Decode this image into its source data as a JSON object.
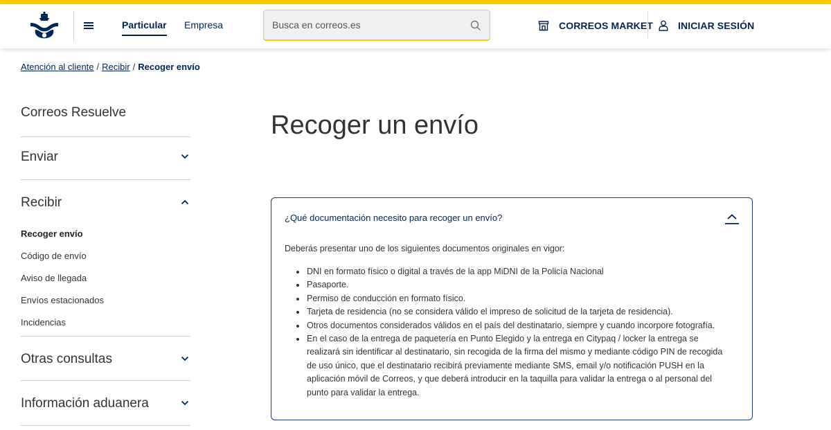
{
  "colors": {
    "brand_yellow": "#ffcd00",
    "brand_navy": "#002453",
    "border_navy": "#1e3d74"
  },
  "header": {
    "logo_icon": "correos-crown-horn-logo",
    "menu_icon": "hamburger-menu-icon",
    "nav": [
      {
        "label": "Particular",
        "active": true
      },
      {
        "label": "Empresa",
        "active": false
      }
    ],
    "search": {
      "placeholder": "Busca en correos.es",
      "value": "",
      "icon": "search-icon"
    },
    "market": {
      "label": "CORREOS MARKET",
      "icon": "store-icon"
    },
    "login": {
      "label": "INICIAR SESIÓN",
      "icon": "user-icon"
    }
  },
  "breadcrumb": {
    "items": [
      "Atención al cliente",
      "Recibir"
    ],
    "separator": "/",
    "current": "Recoger envío"
  },
  "sidebar": {
    "title": "Correos Resuelve",
    "sections": [
      {
        "label": "Enviar",
        "expanded": false
      },
      {
        "label": "Recibir",
        "expanded": true,
        "items": [
          "Recoger envío",
          "Código de envío",
          "Aviso de llegada",
          "Envíos estacionados",
          "Incidencias"
        ],
        "active_item": "Recoger envío"
      },
      {
        "label": "Otras consultas",
        "expanded": false
      },
      {
        "label": "Información aduanera",
        "expanded": false
      }
    ]
  },
  "main": {
    "title": "Recoger un envío",
    "faq": {
      "question": "¿Qué documentación necesito para recoger un envío?",
      "expanded": true,
      "intro": "Deberás presentar uno de los siguientes documentos originales en vigor:",
      "items": [
        "DNI en formato físico o digital a través de la app MiDNI de la Policía Nacional",
        "Pasaporte.",
        "Permiso de conducción en formato físico.",
        "Tarjeta de residencia (no se considera válido el impreso de solicitud de la tarjeta de residencia).",
        "Otros documentos considerados válidos en el país del destinatario, siempre y cuando incorpore fotografía.",
        "En el caso de la entrega de paquetería en Punto Elegido y la entrega en Citypaq / locker la entrega se realizará sin identificar al destinatario, sin recogida de la firma del mismo y mediante código PIN de recogida de uso único, que el destinatario recibirá previamente mediante SMS, email y/o notificación PUSH en la aplicación móvil de Correos, y que deberá introducir en la taquilla para validar la entrega o al personal del punto para validar la entrega."
      ]
    }
  }
}
